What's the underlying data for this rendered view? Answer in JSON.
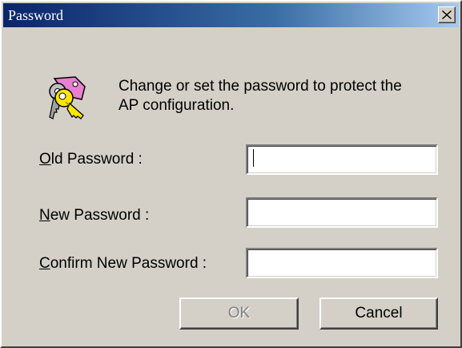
{
  "window": {
    "title": "Password"
  },
  "message": {
    "line1": "Change or set the password to protect the",
    "line2": "AP configuration."
  },
  "fields": {
    "old_password": {
      "accel": "O",
      "rest": "ld Password :",
      "value": ""
    },
    "new_password": {
      "accel": "N",
      "rest": "ew Password :",
      "value": ""
    },
    "confirm_password": {
      "accel": "C",
      "rest": "onfirm New Password :",
      "value": ""
    }
  },
  "buttons": {
    "ok": "OK",
    "cancel": "Cancel"
  },
  "icons": {
    "dialog_icon": "keys-icon",
    "close": "close-icon"
  }
}
